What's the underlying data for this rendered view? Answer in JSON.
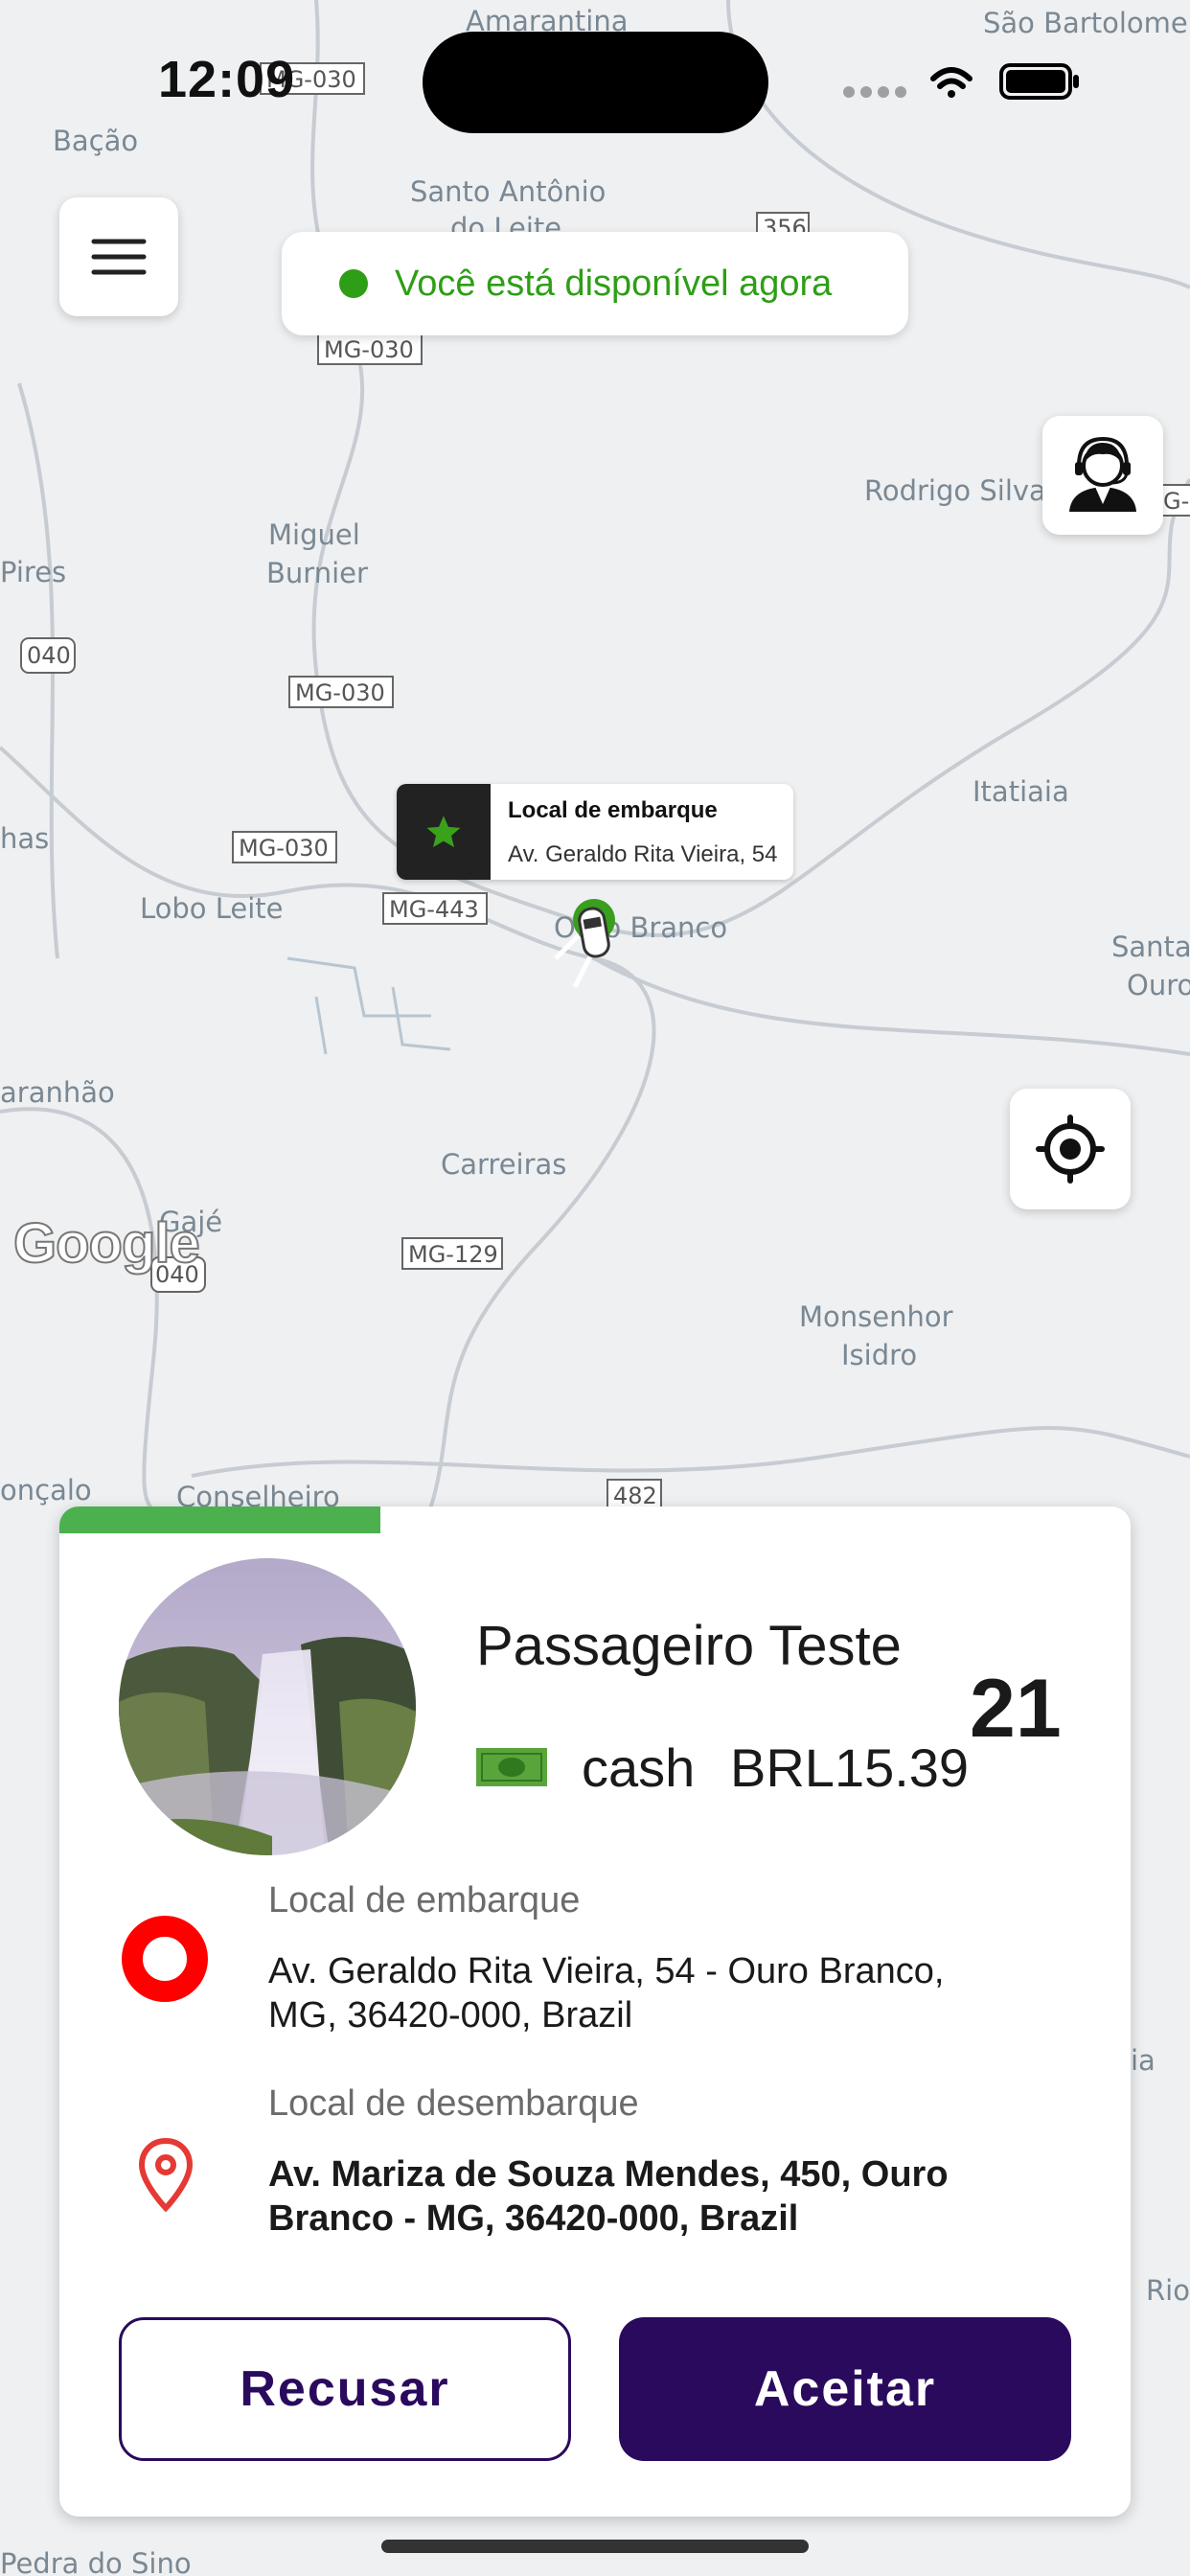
{
  "status_bar": {
    "time": "12:09"
  },
  "map": {
    "labels": [
      "Amarantina",
      "São Bartolomeu",
      "Bação",
      "Santo Antônio",
      "do Leite",
      "Rodrigo Silva",
      "Miguel",
      "Burnier",
      "Pires",
      "has",
      "Lobo Leite",
      "Ouro Branco",
      "Itatiaia",
      "Santa",
      "Ouro",
      "aranhão",
      "Carreiras",
      "Gajé",
      "Monsenhor",
      "Isidro",
      "onçalo",
      "Conselheiro",
      "Pedra do Sino",
      "ia",
      "Rio"
    ],
    "road_shields": [
      "MG-030",
      "356",
      "MG-030",
      "040",
      "MG-030",
      "MG-030",
      "MG-443",
      "MG-129",
      "040",
      "482",
      "G-"
    ],
    "attribution": "Google"
  },
  "header": {
    "menu_icon": "hamburger-menu-icon",
    "availability_text": "Você está disponível agora",
    "availability_color": "#2e9e16",
    "support_icon": "support-agent-icon"
  },
  "pickup_marker": {
    "title": "Local de embarque",
    "address": "Av. Geraldo Rita Vieira, 54"
  },
  "locate_icon": "my-location-icon",
  "ride_request": {
    "progress_fraction": 0.3,
    "progress_color": "#4cb04f",
    "passenger_name": "Passageiro Teste",
    "payment_method": "cash",
    "fare": "BRL15.39",
    "countdown": "21",
    "pickup_label": "Local de embarque",
    "pickup_address": "Av. Geraldo Rita Vieira, 54 - Ouro Branco, MG, 36420-000, Brazil",
    "dropoff_label": "Local de desembarque",
    "dropoff_address": "Av. Mariza de Souza Mendes, 450, Ouro Branco - MG, 36420-000, Brazil",
    "reject_label": "Recusar",
    "accept_label": "Aceitar",
    "accent_color": "#2a0a5c"
  }
}
